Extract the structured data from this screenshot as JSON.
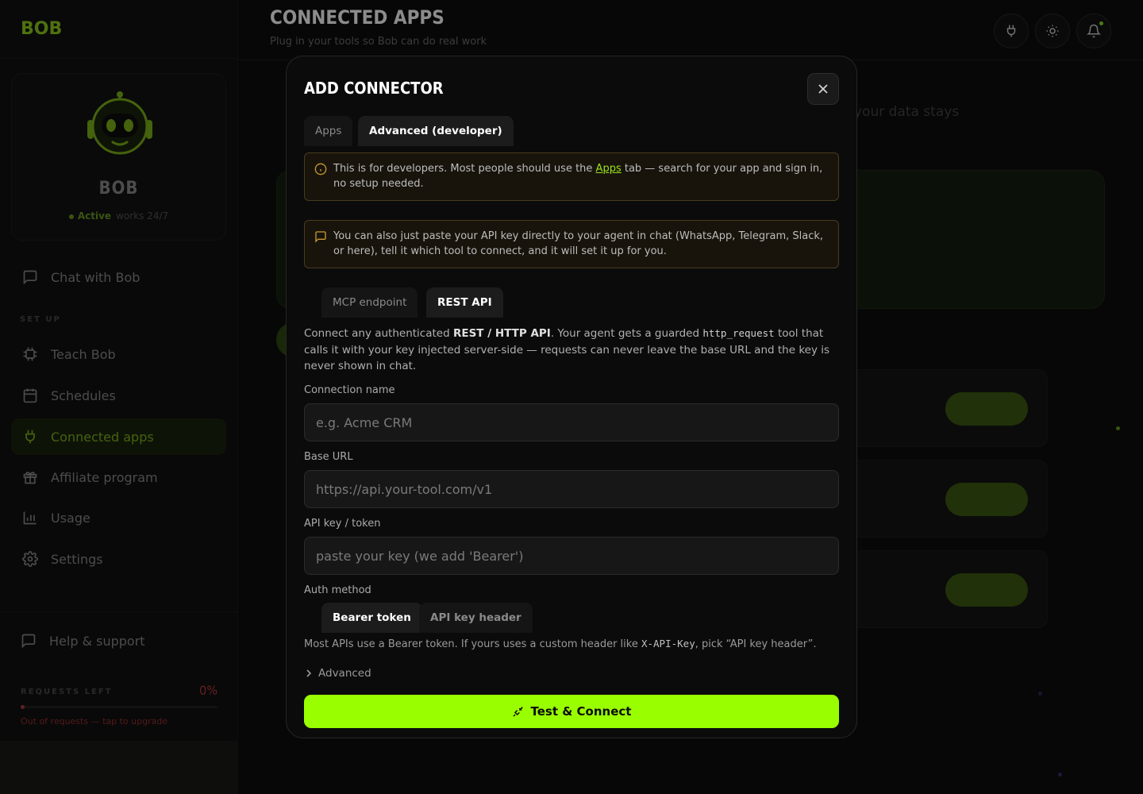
{
  "brand": {
    "logo_text": "BOB",
    "accent": "#99ff00"
  },
  "sidebar": {
    "bot_name": "BOB",
    "status": "Active",
    "status_extra": "works 24/7",
    "chat_item": "Chat with Bob",
    "section_label": "SET UP",
    "items": [
      {
        "label": "Teach Bob",
        "icon": "cpu-icon"
      },
      {
        "label": "Schedules",
        "icon": "calendar-icon"
      },
      {
        "label": "Connected apps",
        "icon": "plug-icon",
        "active": true
      },
      {
        "label": "Affiliate program",
        "icon": "gift-icon"
      },
      {
        "label": "Usage",
        "icon": "bar-chart-icon"
      },
      {
        "label": "Settings",
        "icon": "gear-icon"
      }
    ],
    "help": "Help & support",
    "requests_label": "REQUESTS LEFT",
    "requests_pct": "0%",
    "requests_fraction": 0,
    "requests_note": "Out of requests — tap to upgrade"
  },
  "header": {
    "title": "CONNECTED APPS",
    "subtitle": "Plug in your tools so Bob can do real work"
  },
  "background": {
    "partial_text": "your data stays"
  },
  "modal": {
    "title": "ADD CONNECTOR",
    "tabs": [
      "Apps",
      "Advanced (developer)"
    ],
    "notice1_pre": "This is for developers. Most people should use the ",
    "notice1_link": "Apps",
    "notice1_post": " tab — search for your app and sign in, no setup needed.",
    "notice2": "You can also just paste your API key directly to your agent in chat (WhatsApp, Telegram, Slack, or here), tell it which tool to connect, and it will set it up for you.",
    "subtabs": [
      "MCP endpoint",
      "REST API"
    ],
    "desc_1": "Connect any authenticated ",
    "desc_bold": "REST / HTTP API",
    "desc_2": ". Your agent gets a guarded ",
    "desc_code": "http_request",
    "desc_3": " tool that calls it with your key injected server-side — requests can never leave the base URL and the key is never shown in chat.",
    "fields": {
      "name_label": "Connection name",
      "name_placeholder": "e.g. Acme CRM",
      "url_label": "Base URL",
      "url_placeholder": "https://api.your-tool.com/v1",
      "key_label": "API key / token",
      "key_placeholder": "paste your key (we add 'Bearer')"
    },
    "auth_label": "Auth method",
    "auth_options": [
      "Bearer token",
      "API key header"
    ],
    "hint_1": "Most APIs use a Bearer token. If yours uses a custom header like ",
    "hint_code": "X-API-Key",
    "hint_2": ", pick “API key header”.",
    "advanced": "Advanced",
    "connect_button": "Test & Connect"
  }
}
